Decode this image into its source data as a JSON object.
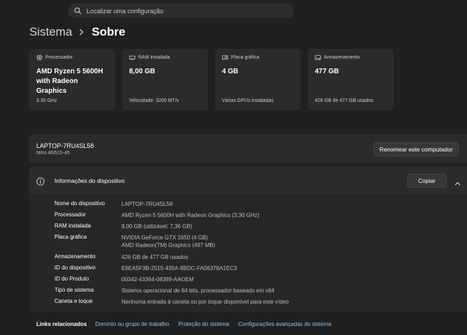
{
  "search": {
    "placeholder": "Localizar uma configuração"
  },
  "breadcrumb": {
    "parent": "Sistema",
    "separator": "›",
    "current": "Sobre"
  },
  "cards": [
    {
      "label": "Processador",
      "value": "AMD Ryzen 5 5600H with Radeon Graphics",
      "sub": "3.30 GHz",
      "icon": "processor-icon"
    },
    {
      "label": "RAM instalada",
      "value": "8,00 GB",
      "sub": "Velocidade: 3200 MT/s",
      "icon": "ram-icon"
    },
    {
      "label": "Placa gráfica",
      "value": "4 GB",
      "sub": "Várias GPUs instaladas",
      "icon": "gpu-icon"
    },
    {
      "label": "Armazenamento",
      "value": "477 GB",
      "sub": "426 GB de 477 GB usados",
      "icon": "storage-icon"
    }
  ],
  "device": {
    "name": "LAPTOP-7RU4SL58",
    "model": "Nitro AN515-45",
    "rename_label": "Renomear este computador"
  },
  "device_info": {
    "title": "Informações do dispositivo",
    "copy_label": "Copiar",
    "specs": [
      {
        "label": "Nome do dispositivo",
        "value": "LAPTOP-7RU4SL58"
      },
      {
        "label": "Processador",
        "value": "AMD Ryzen 5 5600H with Radeon Graphics (3.30 GHz)"
      },
      {
        "label": "RAM instalada",
        "value": "8,00 GB (utilizável: 7,36 GB)"
      },
      {
        "label": "Placa gráfica",
        "value": "NVIDIA GeForce GTX 1650 (4 GB)",
        "value2": "AMD Radeon(TM) Graphics (497 MB)"
      },
      {
        "label": "Armazenamento",
        "value": "426 GB de 477 GB usados"
      },
      {
        "label": "ID do dispositivo",
        "value": "E6EA5F3B-2515-435A-8BDC-FA06378A1EC3"
      },
      {
        "label": "ID do Produto",
        "value": "00342-43364-08399-AAOEM"
      },
      {
        "label": "Tipo de sistema",
        "value": "Sistema operacional de 64 bits, processador baseado em x64"
      },
      {
        "label": "Caneta e toque",
        "value": "Nenhuma entrada à caneta ou por toque disponível para este vídeo"
      }
    ]
  },
  "related": {
    "title": "Links relacionados",
    "links": [
      "Domínio ou grupo de trabalho",
      "Proteção do sistema",
      "Configurações avançadas do sistema"
    ]
  },
  "colors": {
    "background": "#202020",
    "card": "#2b2b2b",
    "link": "#8cc8f5"
  }
}
